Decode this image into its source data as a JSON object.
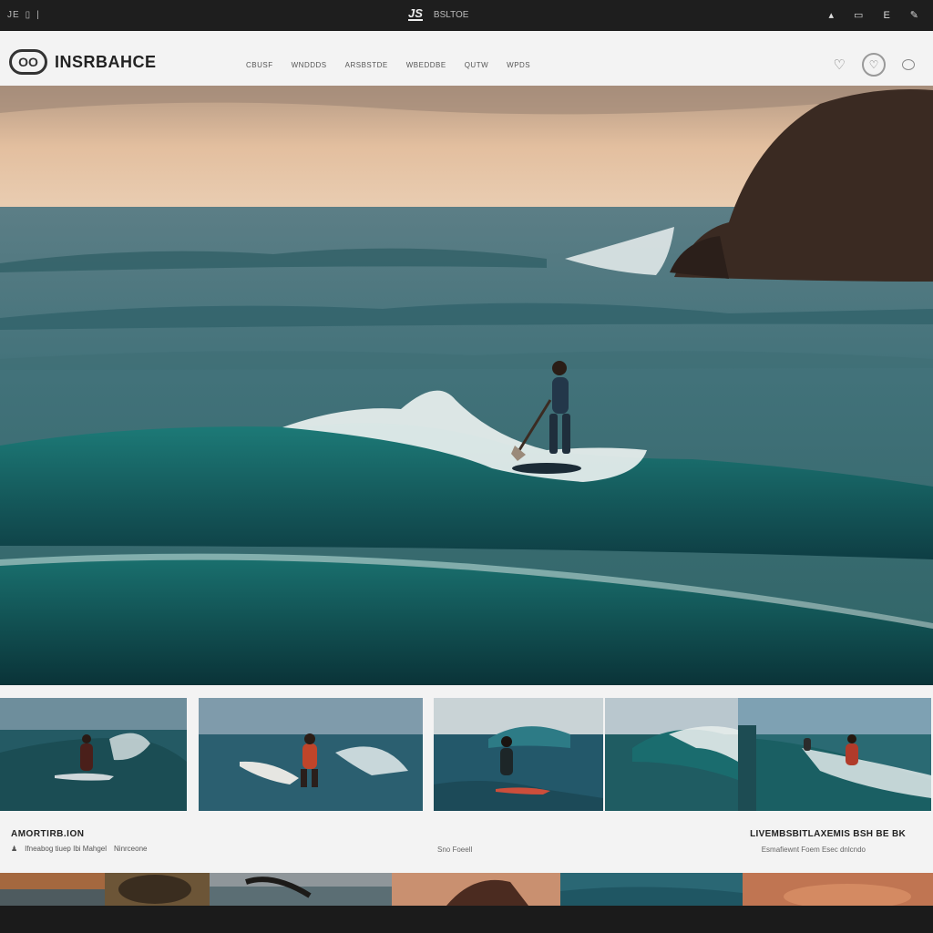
{
  "topbar": {
    "left_text": "JE",
    "left_icons": [
      "square-icon",
      "bar-icon"
    ],
    "center_logo": "JS",
    "center_text": "BSLTOE",
    "right_icons": [
      "cursor-icon",
      "window-icon",
      "menu-e-icon",
      "compose-icon"
    ]
  },
  "header": {
    "brand_mark": "OO",
    "brand_name": "INSRBAHCE",
    "nav": [
      "CBUSF",
      "WNDDDS",
      "ARSBSTDE",
      "WBEDDBE",
      "QUTW",
      "WPDS"
    ],
    "icons": [
      "heart-icon",
      "badge-icon",
      "chat-icon"
    ]
  },
  "captions": {
    "left_title": "AMORTIRB.ION",
    "left_meta_1": "Ifneabog tiuep Ibi Mahgel",
    "left_meta_2": "Ninrceone",
    "middle": "Sno Foeell",
    "right_title": "LIVEMBSBITLAXEMIS BSH BE BK",
    "right_sub": "Esmafiewnt Foem Esec dnlcndo"
  },
  "colors": {
    "topbar": "#1e1e1e",
    "header": "#f3f3f3",
    "ocean_deep": "#0f4a4e",
    "ocean_teal": "#1f6e70",
    "sky_warm": "#e9c7a6"
  }
}
